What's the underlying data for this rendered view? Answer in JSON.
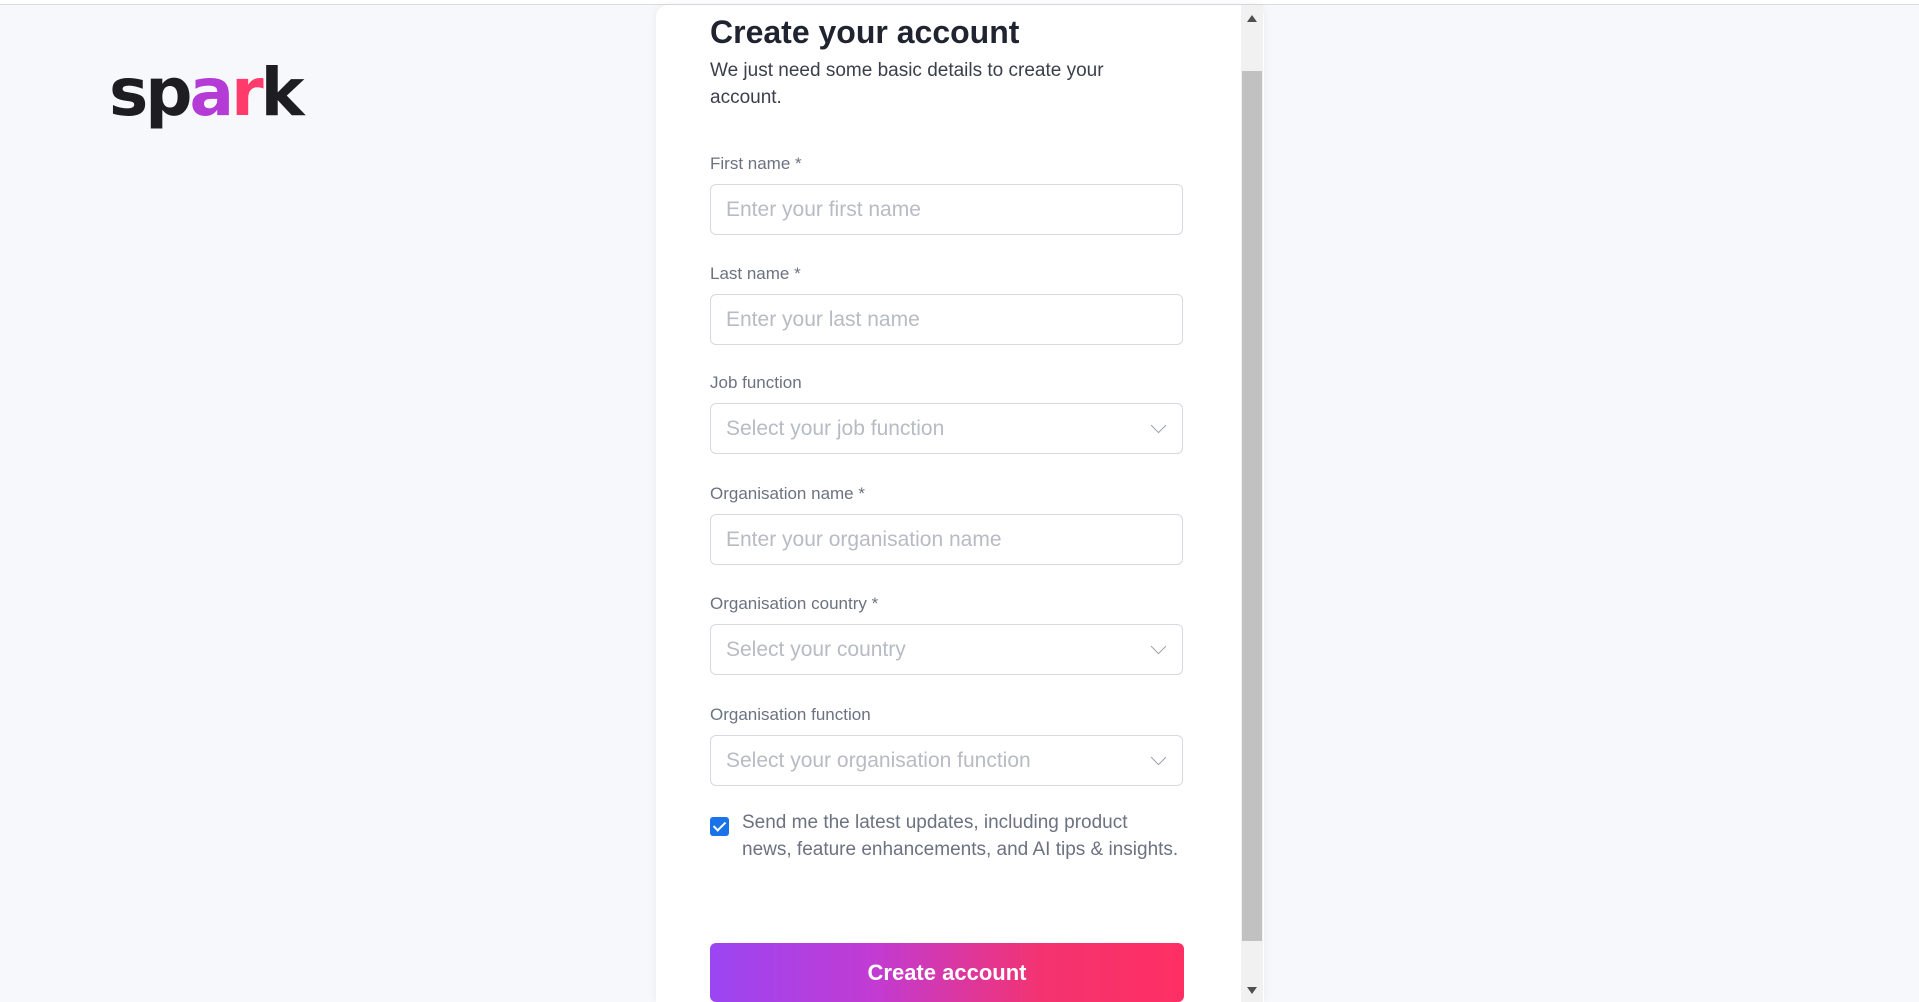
{
  "brand": {
    "logo_parts": [
      "sp",
      "a",
      "r",
      "k"
    ]
  },
  "form": {
    "title": "Create your account",
    "subtitle": "We just need some basic details to create your account.",
    "fields": [
      {
        "label": "First name *",
        "placeholder": "Enter your first name",
        "kind": "text"
      },
      {
        "label": "Last name *",
        "placeholder": "Enter your last name",
        "kind": "text"
      },
      {
        "label": "Job function",
        "placeholder": "Select your job function",
        "kind": "select"
      },
      {
        "label": "Organisation name *",
        "placeholder": "Enter your organisation name",
        "kind": "text"
      },
      {
        "label": "Organisation country *",
        "placeholder": "Select your country",
        "kind": "select"
      },
      {
        "label": "Organisation function",
        "placeholder": "Select your organisation function",
        "kind": "select"
      }
    ],
    "consent": {
      "checked": true,
      "text": "Send me the latest updates, including product news, feature enhancements, and AI tips & insights."
    },
    "submit_label": "Create account"
  },
  "colors": {
    "background": "#f6f8fc",
    "checkbox": "#1a73e8",
    "gradient_start": "#9a46f2",
    "gradient_end": "#ff2f63"
  }
}
